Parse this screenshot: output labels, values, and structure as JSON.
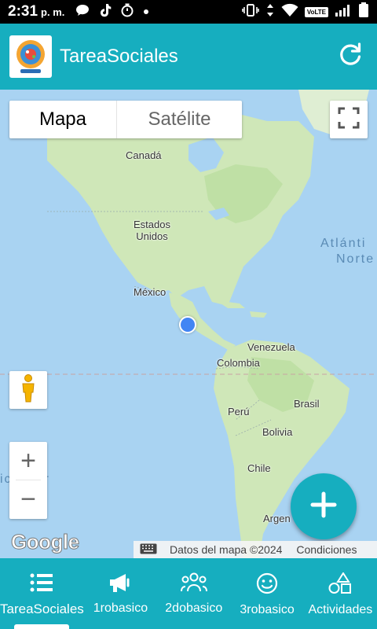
{
  "status_bar": {
    "time": "2:31",
    "ampm": "p. m.",
    "network_badge": "VoLTE",
    "icons": [
      "chat-bubble-icon",
      "tiktok-icon",
      "timer-icon",
      "dot-icon",
      "vibrate-icon",
      "data-arrows-icon",
      "wifi-icon",
      "signal-icon",
      "battery-icon"
    ]
  },
  "app_bar": {
    "title": "TareaSociales",
    "logo_icon": "school-logo",
    "refresh_icon": "refresh-icon",
    "background": "#16aebf"
  },
  "map": {
    "type_options": [
      "Mapa",
      "Satélite"
    ],
    "selected_type": "Mapa",
    "labels": {
      "canada": "Canadá",
      "usa": "Estados\nUnidos",
      "mexico": "México",
      "venezuela": "Venezuela",
      "colombia": "Colombia",
      "peru": "Perú",
      "brasil": "Brasil",
      "bolivia": "Bolivia",
      "chile": "Chile",
      "argentina": "Argen",
      "atlantic_line1": "Atlánti",
      "atlantic_line2": "Norte",
      "pacific": "ico Sur"
    },
    "zoom_in": "+",
    "zoom_out": "−",
    "google": "Google",
    "attribution": "Datos del mapa ©2024",
    "terms": "Condiciones",
    "fab_label": "+"
  },
  "bottom_nav": {
    "items": [
      {
        "label": "TareaSociales",
        "icon": "list-icon",
        "active": true
      },
      {
        "label": "1robasico",
        "icon": "megaphone-icon",
        "active": false
      },
      {
        "label": "2dobasico",
        "icon": "group-icon",
        "active": false
      },
      {
        "label": "3robasico",
        "icon": "smiley-icon",
        "active": false
      },
      {
        "label": "Actividades",
        "icon": "shapes-icon",
        "active": false
      }
    ]
  }
}
